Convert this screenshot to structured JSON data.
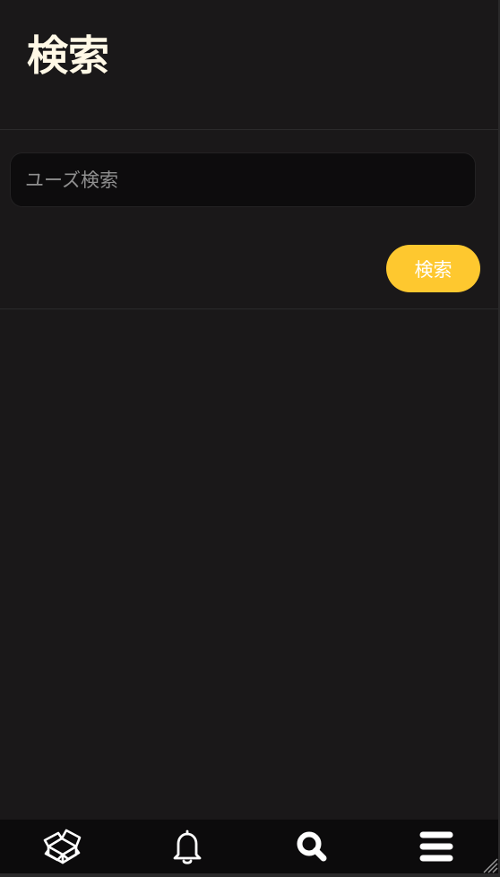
{
  "header": {
    "title": "検索"
  },
  "search": {
    "placeholder": "ユーズ検索",
    "value": "",
    "button_label": "検索"
  },
  "nav": {
    "items": [
      {
        "icon": "open-box-icon"
      },
      {
        "icon": "bell-icon"
      },
      {
        "icon": "search-icon"
      },
      {
        "icon": "menu-icon"
      }
    ]
  },
  "colors": {
    "background": "#1a1819",
    "accent": "#fec82f",
    "nav_background": "#0c0b0c",
    "title": "#fff8e6"
  }
}
